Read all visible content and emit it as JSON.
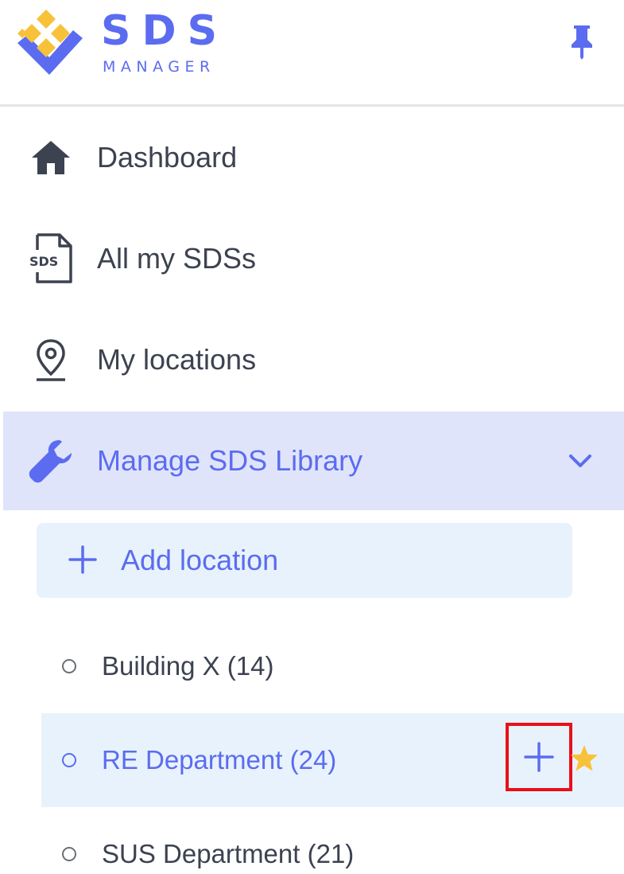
{
  "brand": {
    "name": "SDS",
    "subtitle": "MANAGER",
    "colors": {
      "primary": "#5b6cf0",
      "accent": "#f7c23a",
      "highlight_border": "#e8101a"
    }
  },
  "header": {
    "pin_icon": "pin-icon"
  },
  "nav": {
    "items": [
      {
        "label": "Dashboard",
        "icon": "home-icon"
      },
      {
        "label": "All my SDSs",
        "icon": "sds-document-icon"
      },
      {
        "label": "My locations",
        "icon": "location-pin-icon"
      },
      {
        "label": "Manage SDS Library",
        "icon": "wrench-icon",
        "active": true,
        "expanded": true
      }
    ]
  },
  "library": {
    "add_location_label": "Add location",
    "locations": [
      {
        "name": "Building X",
        "count": "(14)"
      },
      {
        "name": "RE Department",
        "count": "(24)",
        "active": true,
        "favorite": true
      },
      {
        "name": "SUS Department",
        "count": "(21)"
      }
    ]
  }
}
